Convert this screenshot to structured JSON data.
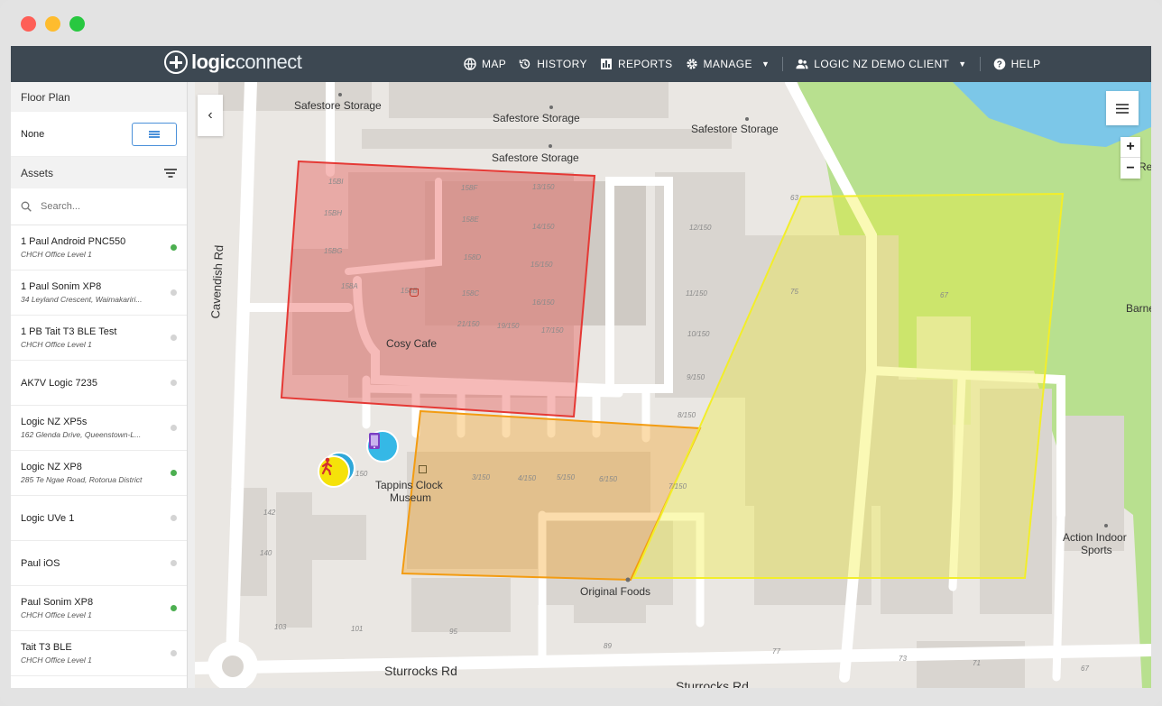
{
  "header": {
    "logo_bold": "logic",
    "logo_light": "connect",
    "nav": [
      {
        "label": "MAP",
        "icon": "globe-icon"
      },
      {
        "label": "HISTORY",
        "icon": "history-icon"
      },
      {
        "label": "REPORTS",
        "icon": "reports-icon"
      },
      {
        "label": "MANAGE",
        "icon": "gear-icon"
      }
    ],
    "client_label": "LOGIC NZ DEMO CLIENT",
    "help_label": "HELP"
  },
  "sidebar": {
    "floor_plan_title": "Floor Plan",
    "floor_plan_value": "None",
    "assets_title": "Assets",
    "search_placeholder": "Search...",
    "assets": [
      {
        "name": "1 Paul Android PNC550",
        "location": "CHCH Office Level 1",
        "online": true
      },
      {
        "name": "1 Paul Sonim XP8",
        "location": "34 Leyland Crescent, Waimakariri...",
        "online": false
      },
      {
        "name": "1 PB Tait T3 BLE Test",
        "location": "CHCH Office Level 1",
        "online": false
      },
      {
        "name": "AK7V Logic 7235",
        "location": "",
        "online": false
      },
      {
        "name": "Logic NZ XP5s",
        "location": "162 Glenda Drive, Queenstown-L...",
        "online": false
      },
      {
        "name": "Logic NZ XP8",
        "location": "285 Te Ngae Road, Rotorua District",
        "online": true
      },
      {
        "name": "Logic UVe 1",
        "location": "",
        "online": false
      },
      {
        "name": "Paul iOS",
        "location": "",
        "online": false
      },
      {
        "name": "Paul Sonim XP8",
        "location": "CHCH Office Level 1",
        "online": true
      },
      {
        "name": "Tait T3 BLE",
        "location": "CHCH Office Level 1",
        "online": false
      }
    ]
  },
  "map": {
    "zoom_in": "+",
    "zoom_out": "−",
    "collapse": "‹",
    "labels": {
      "safestore1": "Safestore Storage",
      "safestore2": "Safestore Storage",
      "safestore3": "Safestore Storage",
      "safestore4": "Safestore Storage",
      "cavendish": "Cavendish Rd",
      "cosy_cafe": "Cosy Cafe",
      "tappins": "Tappins Clock",
      "museum": "Museum",
      "original_foods": "Original Foods",
      "action_indoor": "Action Indoor",
      "sports": "Sports",
      "sturrocks1": "Sturrocks Rd",
      "sturrocks2": "Sturrocks Rd",
      "barnes": "Barnes",
      "re": "Re"
    },
    "numbers": {
      "n1": "15BI",
      "n2": "15BH",
      "n3": "15BG",
      "n4": "158A",
      "n5": "158F",
      "n6": "158E",
      "n7": "158D",
      "n8": "158B",
      "n9": "158C",
      "n10": "13/150",
      "n11": "14/150",
      "n12": "15/150",
      "n13": "16/150",
      "n14": "21/150",
      "n15": "19/150",
      "n16": "17/150",
      "n17": "12/150",
      "n18": "11/150",
      "n19": "10/150",
      "n20": "9/150",
      "n21": "8/150",
      "n22": "3/150",
      "n23": "4/150",
      "n24": "5/150",
      "n25": "6/150",
      "n26": "7/150",
      "n27": "75",
      "n28": "67",
      "n29": "63",
      "n30": "142",
      "n31": "140",
      "n32": "103",
      "n33": "101",
      "n34": "95",
      "n35": "89",
      "n36": "77",
      "n37": "73",
      "n38": "71",
      "n39": "67",
      "n40": "150"
    },
    "colors": {
      "zone_red": "#e53935",
      "zone_orange": "#f39c12",
      "zone_yellow": "#f2ee2a",
      "park": "#b8e08f",
      "water": "#7cc7e8"
    }
  }
}
